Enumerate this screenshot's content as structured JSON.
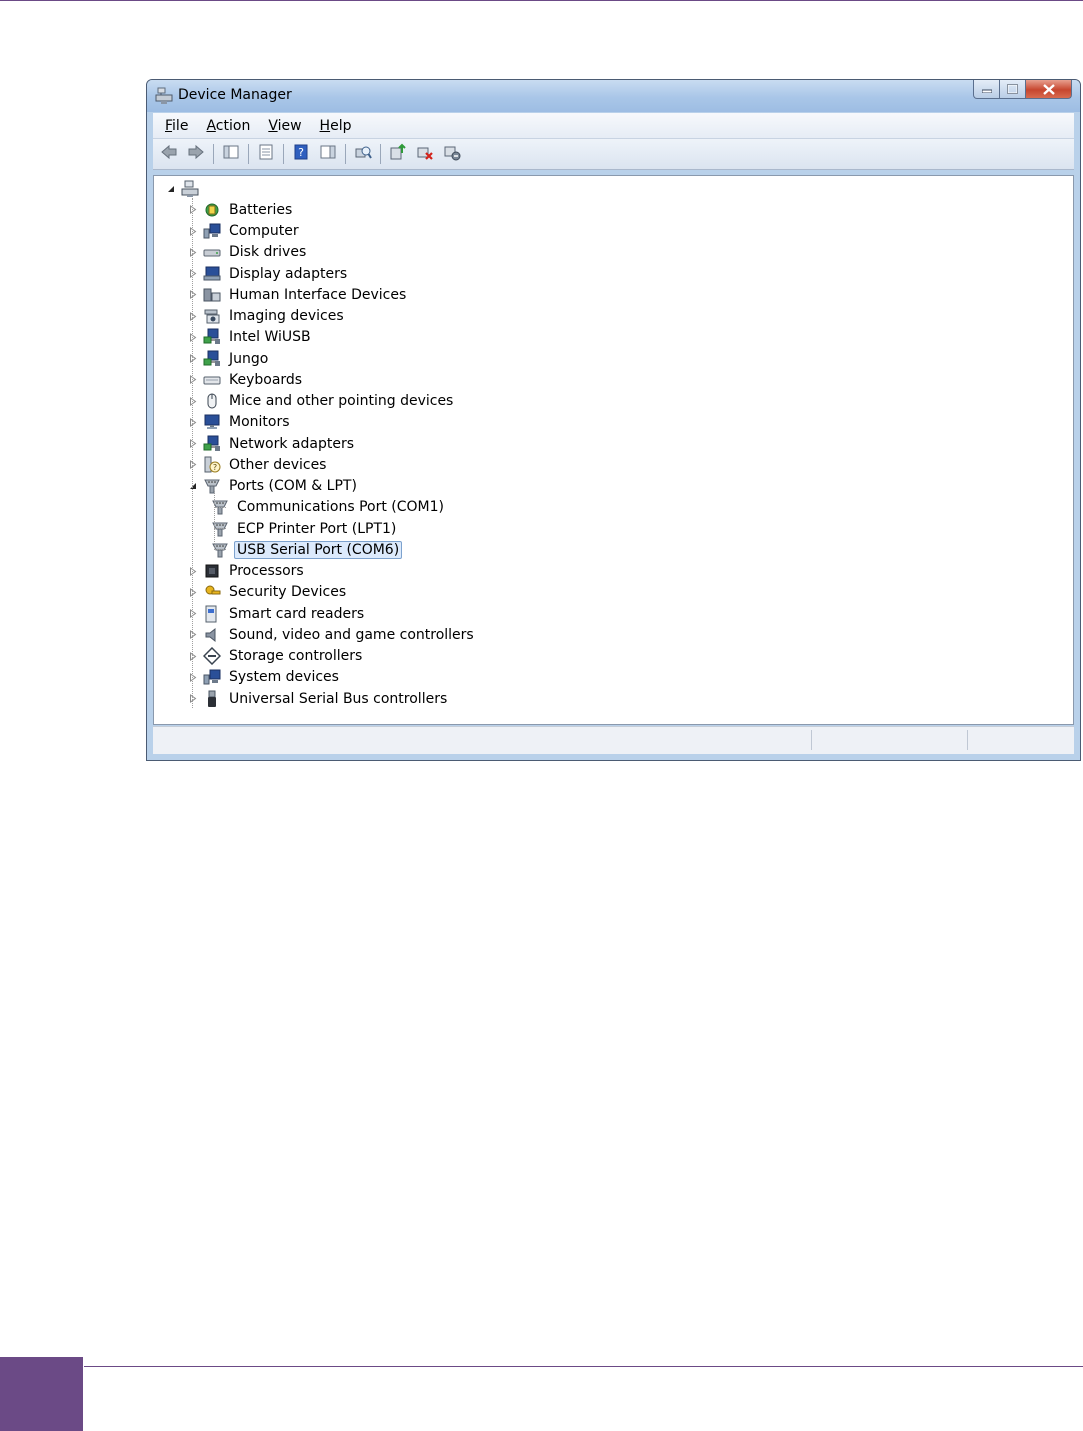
{
  "window": {
    "title": "Device Manager"
  },
  "menu": [
    {
      "label_prefix": "",
      "accel": "F",
      "rest": "ile"
    },
    {
      "label_prefix": "",
      "accel": "A",
      "rest": "ction"
    },
    {
      "label_prefix": "",
      "accel": "V",
      "rest": "iew"
    },
    {
      "label_prefix": "",
      "accel": "H",
      "rest": "elp"
    }
  ],
  "toolbar": [
    "back-icon",
    "forward-icon",
    "|",
    "console-tree-icon",
    "|",
    "properties-icon",
    "|",
    "help-icon",
    "action-pane-icon",
    "|",
    "scan-hardware-icon",
    "|",
    "update-driver-icon",
    "uninstall-icon",
    "disable-device-icon"
  ],
  "tree": {
    "root_icon": "computer-root-icon",
    "categories": [
      {
        "label": "Batteries",
        "icon": "battery-icon"
      },
      {
        "label": "Computer",
        "icon": "computer-icon"
      },
      {
        "label": "Disk drives",
        "icon": "disk-drive-icon"
      },
      {
        "label": "Display adapters",
        "icon": "display-adapter-icon"
      },
      {
        "label": "Human Interface Devices",
        "icon": "hid-icon"
      },
      {
        "label": "Imaging devices",
        "icon": "camera-icon"
      },
      {
        "label": "Intel WiUSB",
        "icon": "network-icon"
      },
      {
        "label": "Jungo",
        "icon": "network-icon"
      },
      {
        "label": "Keyboards",
        "icon": "keyboard-icon"
      },
      {
        "label": "Mice and other pointing devices",
        "icon": "mouse-icon"
      },
      {
        "label": "Monitors",
        "icon": "monitor-icon"
      },
      {
        "label": "Network adapters",
        "icon": "network-icon"
      },
      {
        "label": "Other devices",
        "icon": "unknown-device-icon"
      },
      {
        "label": "Ports (COM & LPT)",
        "icon": "port-icon",
        "expanded": true,
        "children": [
          {
            "label": "Communications Port (COM1)"
          },
          {
            "label": "ECP Printer Port (LPT1)"
          },
          {
            "label": "USB Serial Port (COM6)",
            "selected": true
          }
        ]
      },
      {
        "label": "Processors",
        "icon": "processor-icon"
      },
      {
        "label": "Security Devices",
        "icon": "security-key-icon"
      },
      {
        "label": "Smart card readers",
        "icon": "smart-card-icon"
      },
      {
        "label": "Sound, video and game controllers",
        "icon": "speaker-icon"
      },
      {
        "label": "Storage controllers",
        "icon": "storage-icon"
      },
      {
        "label": "System devices",
        "icon": "computer-icon"
      },
      {
        "label": "Universal Serial Bus controllers",
        "icon": "usb-icon"
      }
    ]
  },
  "colors": {
    "accent_purple": "#6b4a86",
    "selection": "#dceafc",
    "selection_border": "#7da2ce"
  }
}
